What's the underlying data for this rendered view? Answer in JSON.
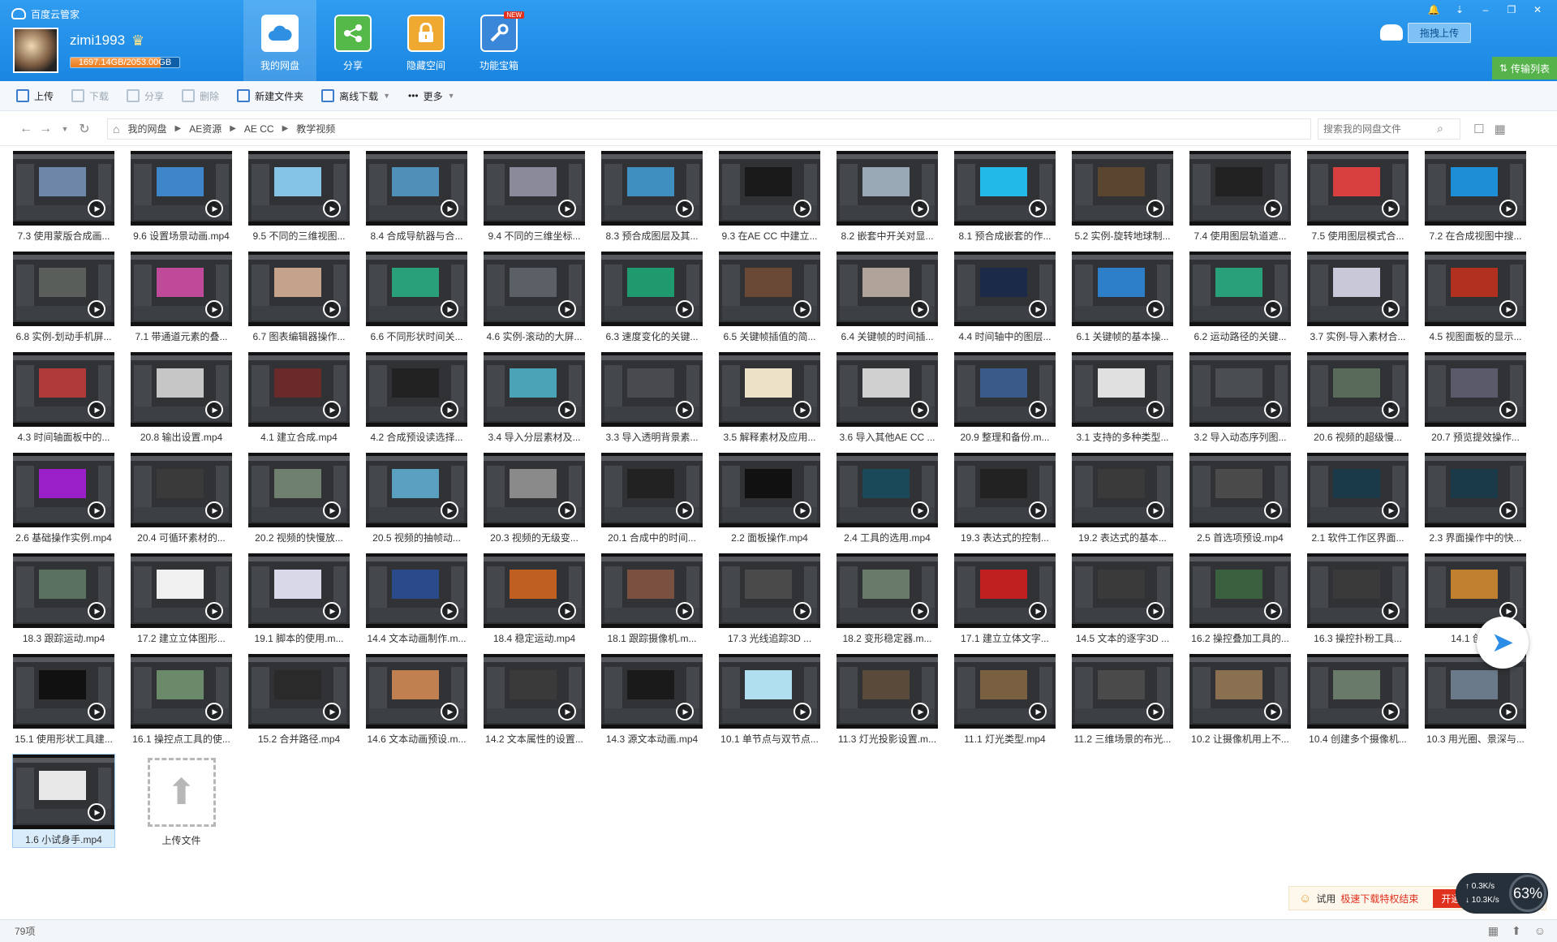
{
  "app": {
    "title": "百度云管家"
  },
  "user": {
    "name": "zimi1993",
    "quota_text": "1697.14GB/2053.00GB",
    "quota_used_fraction": 0.827
  },
  "nav": [
    {
      "label": "我的网盘",
      "icon": "cloud-disk-icon"
    },
    {
      "label": "分享",
      "icon": "share-icon"
    },
    {
      "label": "隐藏空间",
      "icon": "lock-icon"
    },
    {
      "label": "功能宝箱",
      "icon": "toolbox-icon",
      "badge": "NEW"
    }
  ],
  "header": {
    "drag_upload": "拖拽上传",
    "transfer_list": "传输列表"
  },
  "toolbar": {
    "upload": "上传",
    "download": "下载",
    "share": "分享",
    "delete": "删除",
    "new_folder": "新建文件夹",
    "offline_download": "离线下载",
    "more": "更多"
  },
  "breadcrumb": [
    "我的网盘",
    "AE资源",
    "AE CC",
    "教学视频"
  ],
  "search": {
    "placeholder": "搜索我的网盘文件"
  },
  "files": [
    "7.3 使用蒙版合成画...",
    "9.6 设置场景动画.mp4",
    "9.5 不同的三维视图...",
    "8.4 合成导航器与合...",
    "9.4 不同的三维坐标...",
    "8.3 预合成图层及其...",
    "9.3 在AE CC 中建立...",
    "8.2 嵌套中开关对显...",
    "8.1 预合成嵌套的作...",
    "5.2 实例-旋转地球制...",
    "7.4 使用图层轨道遮...",
    "7.5 使用图层模式合...",
    "7.2 在合成视图中搜...",
    "6.8 实例-划动手机屏...",
    "7.1 带通道元素的叠...",
    "6.7 图表编辑器操作...",
    "6.6 不同形状时间关...",
    "4.6 实例-滚动的大屏...",
    "6.3 速度变化的关键...",
    "6.5 关键帧插值的简...",
    "6.4 关键帧的时间插...",
    "4.4 时间轴中的图层...",
    "6.1 关键帧的基本操...",
    "6.2 运动路径的关键...",
    "3.7 实例-导入素材合...",
    "4.5 视图面板的显示...",
    "4.3 时间轴面板中的...",
    "20.8 输出设置.mp4",
    "4.1 建立合成.mp4",
    "4.2 合成预设读选择...",
    "3.4 导入分层素材及...",
    "3.3 导入透明背景素...",
    "3.5 解释素材及应用...",
    "3.6 导入其他AE CC ...",
    "20.9 整理和备份.m...",
    "3.1 支持的多种类型...",
    "3.2 导入动态序列图...",
    "20.6 视频的超级慢...",
    "20.7 预览提效操作...",
    "2.6 基础操作实例.mp4",
    "20.4 可循环素材的...",
    "20.2 视频的快慢放...",
    "20.5 视频的抽帧动...",
    "20.3 视频的无级变...",
    "20.1 合成中的时间...",
    "2.2 面板操作.mp4",
    "2.4 工具的选用.mp4",
    "19.3 表达式的控制...",
    "19.2 表达式的基本...",
    "2.5 首选项预设.mp4",
    "2.1 软件工作区界面...",
    "2.3 界面操作中的快...",
    "18.3 跟踪运动.mp4",
    "17.2 建立立体图形...",
    "19.1 脚本的使用.m...",
    "14.4 文本动画制作.m...",
    "18.4 稳定运动.mp4",
    "18.1 跟踪摄像机.m...",
    "17.3 光线追踪3D ...",
    "18.2 变形稳定器.m...",
    "17.1 建立立体文字...",
    "14.5 文本的逐字3D ...",
    "16.2 操控叠加工具的...",
    "16.3 操控扑粉工具...",
    "14.1 创建...",
    "15.1 使用形状工具建...",
    "16.1 操控点工具的使...",
    "15.2 合并路径.mp4",
    "14.6 文本动画预设.m...",
    "14.2 文本属性的设置...",
    "14.3 源文本动画.mp4",
    "10.1 单节点与双节点...",
    "11.3 灯光投影设置.m...",
    "11.1 灯光类型.mp4",
    "11.2 三维场景的布光...",
    "10.2 让摄像机用上不...",
    "10.4 创建多个摄像机...",
    "10.3 用光圈、景深与...",
    "1.6 小试身手.mp4"
  ],
  "upload_tile_label": "上传文件",
  "thumb_colors": [
    "#6e86a8",
    "#3e86c9",
    "#86c4e6",
    "#4f8fb8",
    "#8a8a9a",
    "#3f8fc0",
    "#1a1a1a",
    "#9aa9b6",
    "#22b9e8",
    "#5a4630",
    "#222",
    "#d84040",
    "#1d8fd6",
    "#5a5e5a",
    "#c04a9a",
    "#c4a38a",
    "#2aa07a",
    "#5a6066",
    "#1f9a6e",
    "#6a4a36",
    "#b0a49a",
    "#1c2a4a",
    "#2c7fc8",
    "#2aa07a",
    "#c8c8d8",
    "#b23020",
    "#b03a3a",
    "#c6c6c6",
    "#6a2a2a",
    "#222",
    "#4aa3b6",
    "#484a4e",
    "#ece2c8",
    "#d0d0d0",
    "#3a5a8a",
    "#e0e0e0",
    "#4a4d52",
    "#5a6a5a",
    "#5a5a6a",
    "#9b1fc8",
    "#3a3a3a",
    "#708070",
    "#5aa0c0",
    "#8a8a8a",
    "#222",
    "#111",
    "#1a4a5a",
    "#222",
    "#3a3a3a",
    "#4a4a4a",
    "#1a3a4a",
    "#1a3a4a",
    "#5a7060",
    "#f0f0f0",
    "#d8d8e8",
    "#2a4a8a",
    "#c06020",
    "#7a5040",
    "#4a4a4a",
    "#6a7a6a",
    "#c02020",
    "#3a3a3a",
    "#3a6040",
    "#3a3a3a",
    "#c08030",
    "#111",
    "#6a8a6a",
    "#2a2a2a",
    "#c08050",
    "#3a3a3a",
    "#1a1a1a",
    "#b0e0f0",
    "#5a4a3a",
    "#7a6040",
    "#4a4a4a",
    "#8a7050",
    "#6a7a6a",
    "#6a7a8a",
    "#e8e8e8"
  ],
  "promo": {
    "text_prefix": "试用",
    "text_highlight": "极速下载特权结束",
    "button": "开通"
  },
  "speed": {
    "upload": "0.3K/s",
    "download": "10.3K/s",
    "percent": "63%"
  },
  "status": {
    "item_count": "79项"
  }
}
